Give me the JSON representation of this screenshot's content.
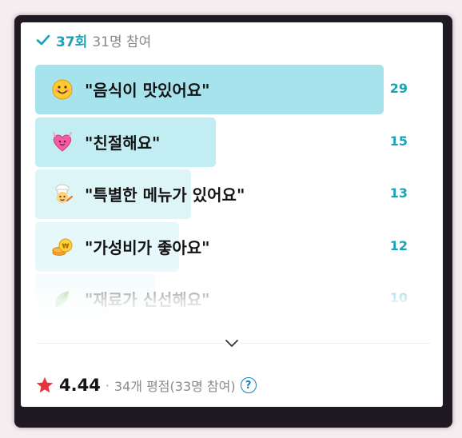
{
  "header": {
    "count": "37회",
    "participants": "31명 참여"
  },
  "items": [
    {
      "label": "\"음식이 맛있어요\"",
      "votes": "29",
      "emoji": "smiling-face-icon",
      "share": 0.293,
      "bar_color": "#a6e3ed"
    },
    {
      "label": "\"친절해요\"",
      "votes": "15",
      "emoji": "pink-heart-icon",
      "share": 0.152,
      "bar_color": "#c2edf3"
    },
    {
      "label": "\"특별한 메뉴가 있어요\"",
      "votes": "13",
      "emoji": "chef-icon",
      "share": 0.131,
      "bar_color": "#def5f8"
    },
    {
      "label": "\"가성비가 좋아요\"",
      "votes": "12",
      "emoji": "coins-icon",
      "share": 0.121,
      "bar_color": "#e6f8fa"
    },
    {
      "label": "\"재료가 신선해요\"",
      "votes": "10",
      "emoji": "leaf-icon",
      "share": 0.101,
      "bar_color": "#eefafc"
    }
  ],
  "footer": {
    "score": "4.44",
    "separator": "·",
    "ratings": "34개 평점(33명 참여)",
    "help": "?"
  },
  "colors": {
    "accent": "#1aa3b4",
    "star": "#e8343f"
  }
}
